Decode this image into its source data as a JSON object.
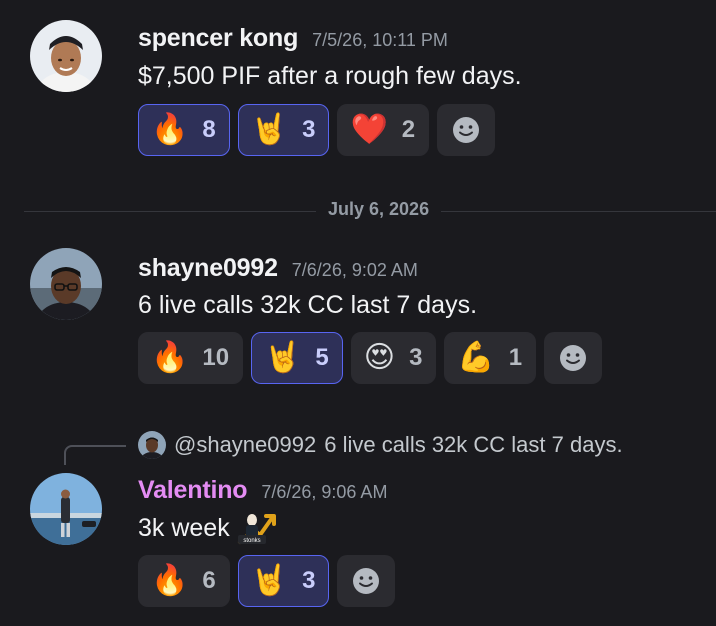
{
  "messages": [
    {
      "username": "spencer kong",
      "timestamp": "7/5/26, 10:11 PM",
      "content": "$7,500 PIF after a rough few days.",
      "reactions": [
        {
          "emoji": "🔥",
          "icon": "fire-icon",
          "count": "8",
          "active": true
        },
        {
          "emoji": "🤘",
          "icon": "rock-on-icon",
          "count": "3",
          "active": true
        },
        {
          "emoji": "❤️",
          "icon": "heart-icon",
          "count": "2",
          "active": false
        }
      ]
    },
    {
      "username": "shayne0992",
      "timestamp": "7/6/26, 9:02 AM",
      "content": "6 live calls 32k CC last 7 days.",
      "reactions": [
        {
          "emoji": "🔥",
          "icon": "fire-icon",
          "count": "10",
          "active": false
        },
        {
          "emoji": "🤘",
          "icon": "rock-on-icon",
          "count": "5",
          "active": true
        },
        {
          "emoji": "😍",
          "icon": "heart-eyes-icon",
          "count": "3",
          "active": false
        },
        {
          "emoji": "💪",
          "icon": "flexed-biceps-icon",
          "count": "1",
          "active": false
        }
      ]
    },
    {
      "username": "Valentino",
      "username_color": "#e48cf3",
      "timestamp": "7/6/26, 9:06 AM",
      "content": "3k week",
      "custom_emoji_label": "stonks",
      "reply": {
        "mention": "@shayne0992",
        "text": "6 live calls 32k CC last 7 days."
      },
      "reactions": [
        {
          "emoji": "🔥",
          "icon": "fire-icon",
          "count": "6",
          "active": false
        },
        {
          "emoji": "🤘",
          "icon": "rock-on-icon",
          "count": "3",
          "active": true
        }
      ]
    }
  ],
  "date_divider": "July 6, 2026",
  "colors": {
    "background": "#1a1a1e",
    "accent": "#5865f2",
    "active_reaction_bg": "#2e3058"
  }
}
